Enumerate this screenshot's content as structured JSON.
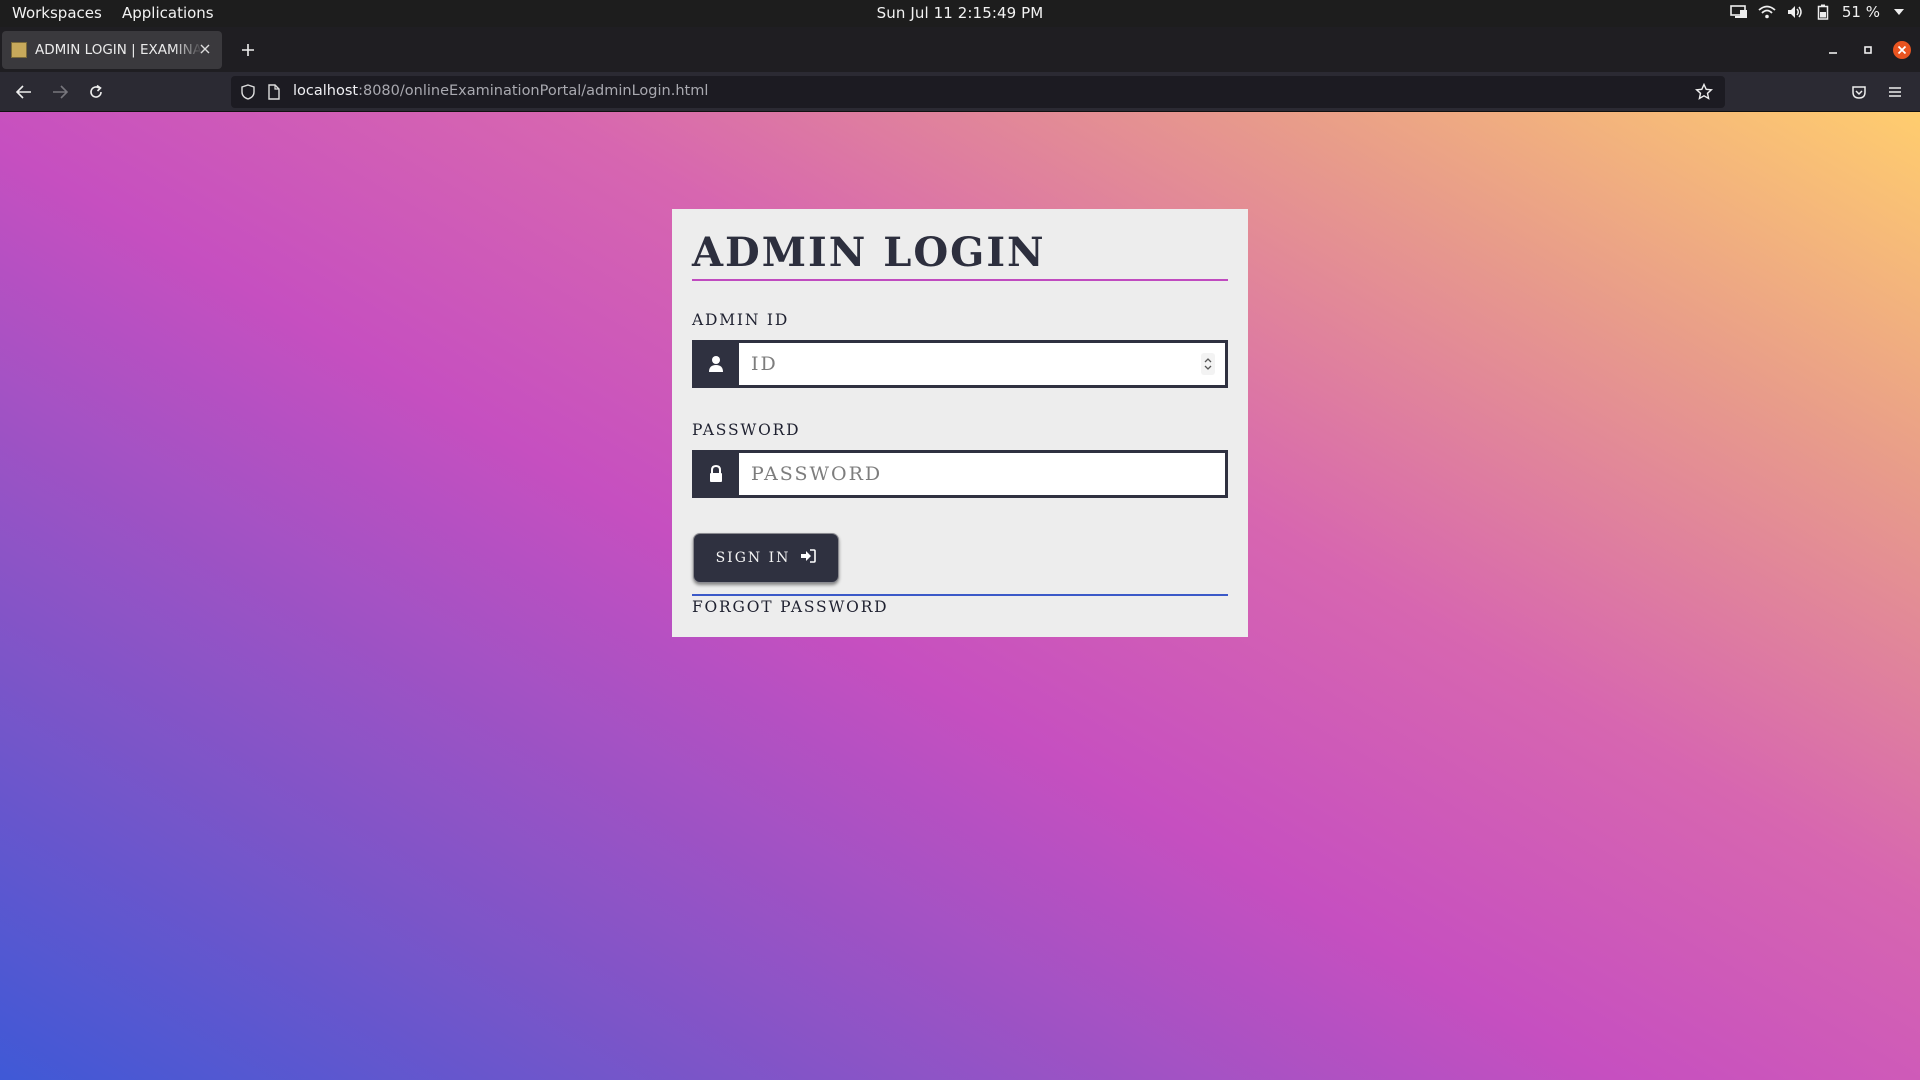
{
  "topbar": {
    "workspaces": "Workspaces",
    "applications": "Applications",
    "clock": "Sun Jul 11  2:15:49 PM",
    "battery_percent": "51 %",
    "tray_icons": [
      "display-icon",
      "wifi-icon",
      "volume-icon",
      "battery-icon",
      "caret-down-icon"
    ]
  },
  "browser": {
    "tab": {
      "title": "ADMIN LOGIN | EXAMINATION PORTAL"
    },
    "url": {
      "host": "localhost",
      "rest": ":8080/onlineExaminationPortal/adminLogin.html"
    }
  },
  "page": {
    "title": "ADMIN LOGIN",
    "admin_id": {
      "label": "ADMIN ID",
      "placeholder": "ID"
    },
    "password": {
      "label": "PASSWORD",
      "placeholder": "PASSWORD"
    },
    "sign_in": "SIGN IN",
    "forgot_password": "FORGOT PASSWORD"
  },
  "colors": {
    "card_bg": "#ededed",
    "accent_dark": "#2f3140",
    "title_underline": "#c04bbf",
    "forgot_underline": "#3b59c8",
    "gradient": [
      "#3f59d6",
      "#c64fc0",
      "#ffcd6e"
    ]
  }
}
